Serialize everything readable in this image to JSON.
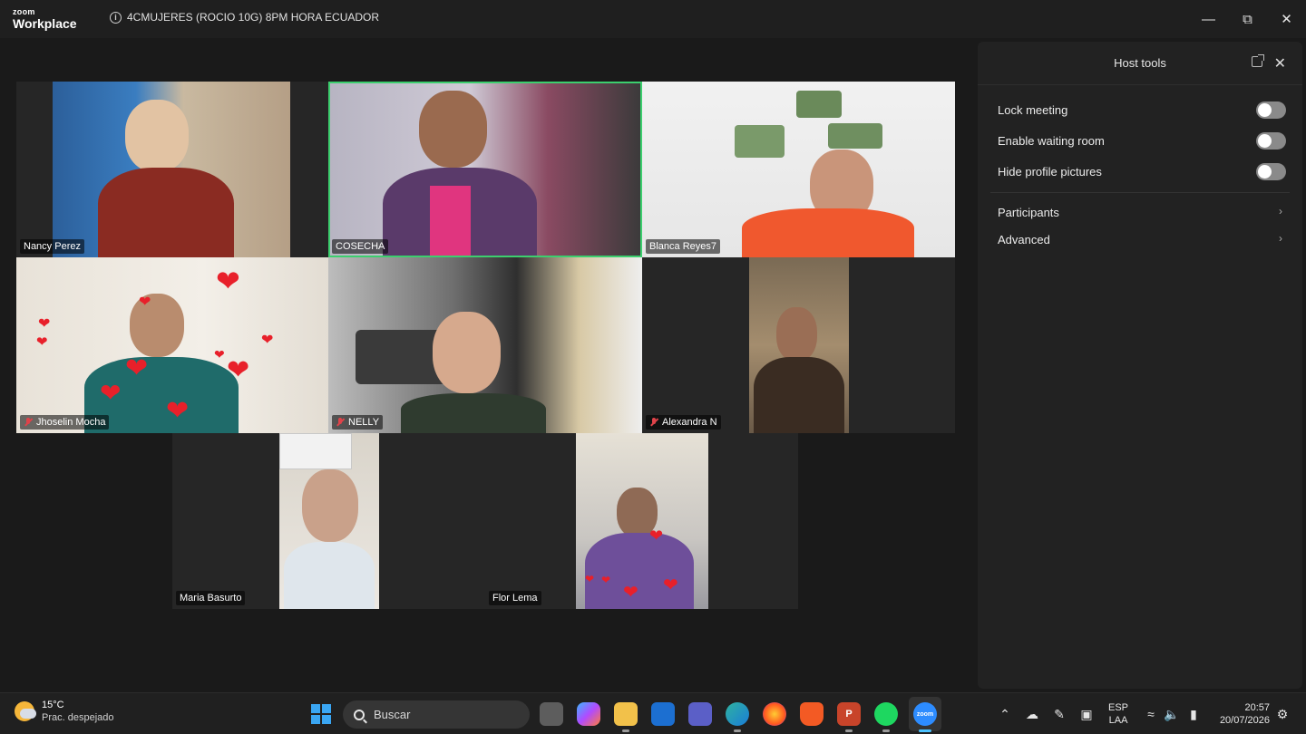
{
  "app": {
    "logo_top": "zoom",
    "logo_bottom": "Workplace",
    "meeting_title": "4CMUJERES (ROCIO 10G) 8PM HORA ECUADOR"
  },
  "participants": [
    {
      "name": "Nancy Perez",
      "muted": false,
      "active_speaker": false
    },
    {
      "name": "COSECHA",
      "muted": false,
      "active_speaker": true
    },
    {
      "name": "Blanca Reyes7",
      "muted": false,
      "active_speaker": false
    },
    {
      "name": "Jhoselin Mocha",
      "muted": true,
      "active_speaker": false
    },
    {
      "name": "NELLY",
      "muted": true,
      "active_speaker": false
    },
    {
      "name": "Alexandra N",
      "muted": true,
      "active_speaker": false
    },
    {
      "name": "Maria Basurto",
      "muted": false,
      "active_speaker": false
    },
    {
      "name": "Flor Lema",
      "muted": false,
      "active_speaker": false
    }
  ],
  "host_tools": {
    "title": "Host tools",
    "toggles": [
      {
        "label": "Lock meeting",
        "on": false
      },
      {
        "label": "Enable waiting room",
        "on": false
      },
      {
        "label": "Hide profile pictures",
        "on": false
      }
    ],
    "links": [
      {
        "label": "Participants"
      },
      {
        "label": "Advanced"
      }
    ]
  },
  "taskbar": {
    "weather_temp": "15°C",
    "weather_desc": "Prac. despejado",
    "search_placeholder": "Buscar",
    "lang_top": "ESP",
    "lang_bottom": "LAA",
    "time": "20:57",
    "date": "20/07/2026"
  },
  "colors": {
    "active_speaker_border": "#3ccf6e",
    "muted_icon": "#e0434a",
    "accent_windows": "#3aa6f3"
  }
}
